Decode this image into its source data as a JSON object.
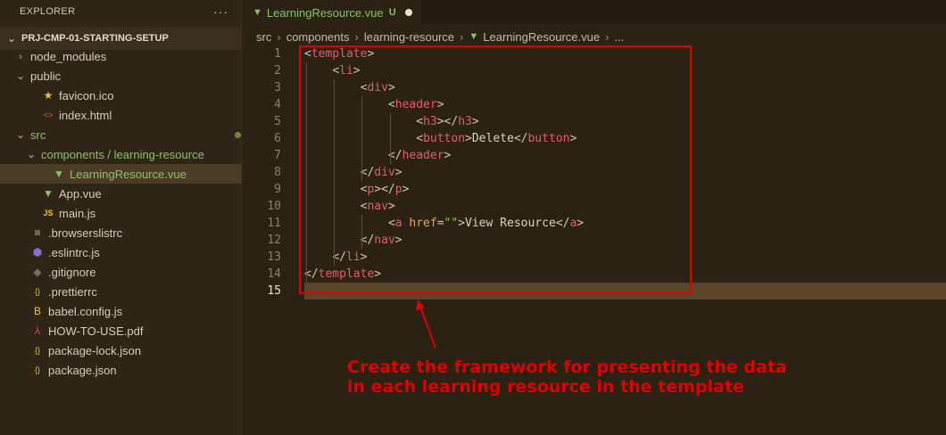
{
  "explorer": {
    "title": "EXPLORER",
    "more": "···",
    "project": "PRJ-CMP-01-STARTING-SETUP",
    "items": [
      {
        "label": "node_modules",
        "indent": 1,
        "chevron": "›",
        "icon": "",
        "status": ""
      },
      {
        "label": "public",
        "indent": 1,
        "chevron": "⌄",
        "icon": "",
        "status": ""
      },
      {
        "label": "favicon.ico",
        "indent": 2,
        "chevron": "",
        "icon": "star-icon",
        "status": ""
      },
      {
        "label": "index.html",
        "indent": 2,
        "chevron": "",
        "icon": "html-icon",
        "status": ""
      },
      {
        "label": "src",
        "indent": 1,
        "chevron": "⌄",
        "icon": "",
        "status": "dot"
      },
      {
        "label": "components / learning-resource",
        "indent": 2,
        "chevron": "⌄",
        "icon": "",
        "status": "dot"
      },
      {
        "label": "LearningResource.vue",
        "indent": 3,
        "chevron": "",
        "icon": "vue-icon",
        "status": "U",
        "active": true
      },
      {
        "label": "App.vue",
        "indent": 2,
        "chevron": "",
        "icon": "vue-icon",
        "status": ""
      },
      {
        "label": "main.js",
        "indent": 2,
        "chevron": "",
        "icon": "js-icon",
        "status": ""
      },
      {
        "label": ".browserslistrc",
        "indent": 1,
        "chevron": "",
        "icon": "list-icon",
        "status": ""
      },
      {
        "label": ".eslintrc.js",
        "indent": 1,
        "chevron": "",
        "icon": "eslint-icon",
        "status": ""
      },
      {
        "label": ".gitignore",
        "indent": 1,
        "chevron": "",
        "icon": "git-icon",
        "status": ""
      },
      {
        "label": ".prettierrc",
        "indent": 1,
        "chevron": "",
        "icon": "braces-icon",
        "status": ""
      },
      {
        "label": "babel.config.js",
        "indent": 1,
        "chevron": "",
        "icon": "babel-icon",
        "status": ""
      },
      {
        "label": "HOW-TO-USE.pdf",
        "indent": 1,
        "chevron": "",
        "icon": "pdf-icon",
        "status": ""
      },
      {
        "label": "package-lock.json",
        "indent": 1,
        "chevron": "",
        "icon": "braces-icon",
        "status": ""
      },
      {
        "label": "package.json",
        "indent": 1,
        "chevron": "",
        "icon": "braces-icon",
        "status": ""
      }
    ]
  },
  "tab": {
    "label": "LearningResource.vue",
    "status": "U"
  },
  "breadcrumb": [
    "src",
    "components",
    "learning-resource",
    "LearningResource.vue",
    "..."
  ],
  "code_lines": [
    "<template>",
    "    <li>",
    "        <div>",
    "            <header>",
    "                <h3></h3>",
    "                <button>Delete</button>",
    "            </header>",
    "        </div>",
    "        <p></p>",
    "        <nav>",
    "            <a href=\"\">View Resource</a>",
    "        </nav>",
    "    </li>",
    "</template>",
    ""
  ],
  "current_line": 15,
  "annotation": {
    "line1": "Create the framework for presenting the data",
    "line2": "in each learning resource in the template"
  }
}
